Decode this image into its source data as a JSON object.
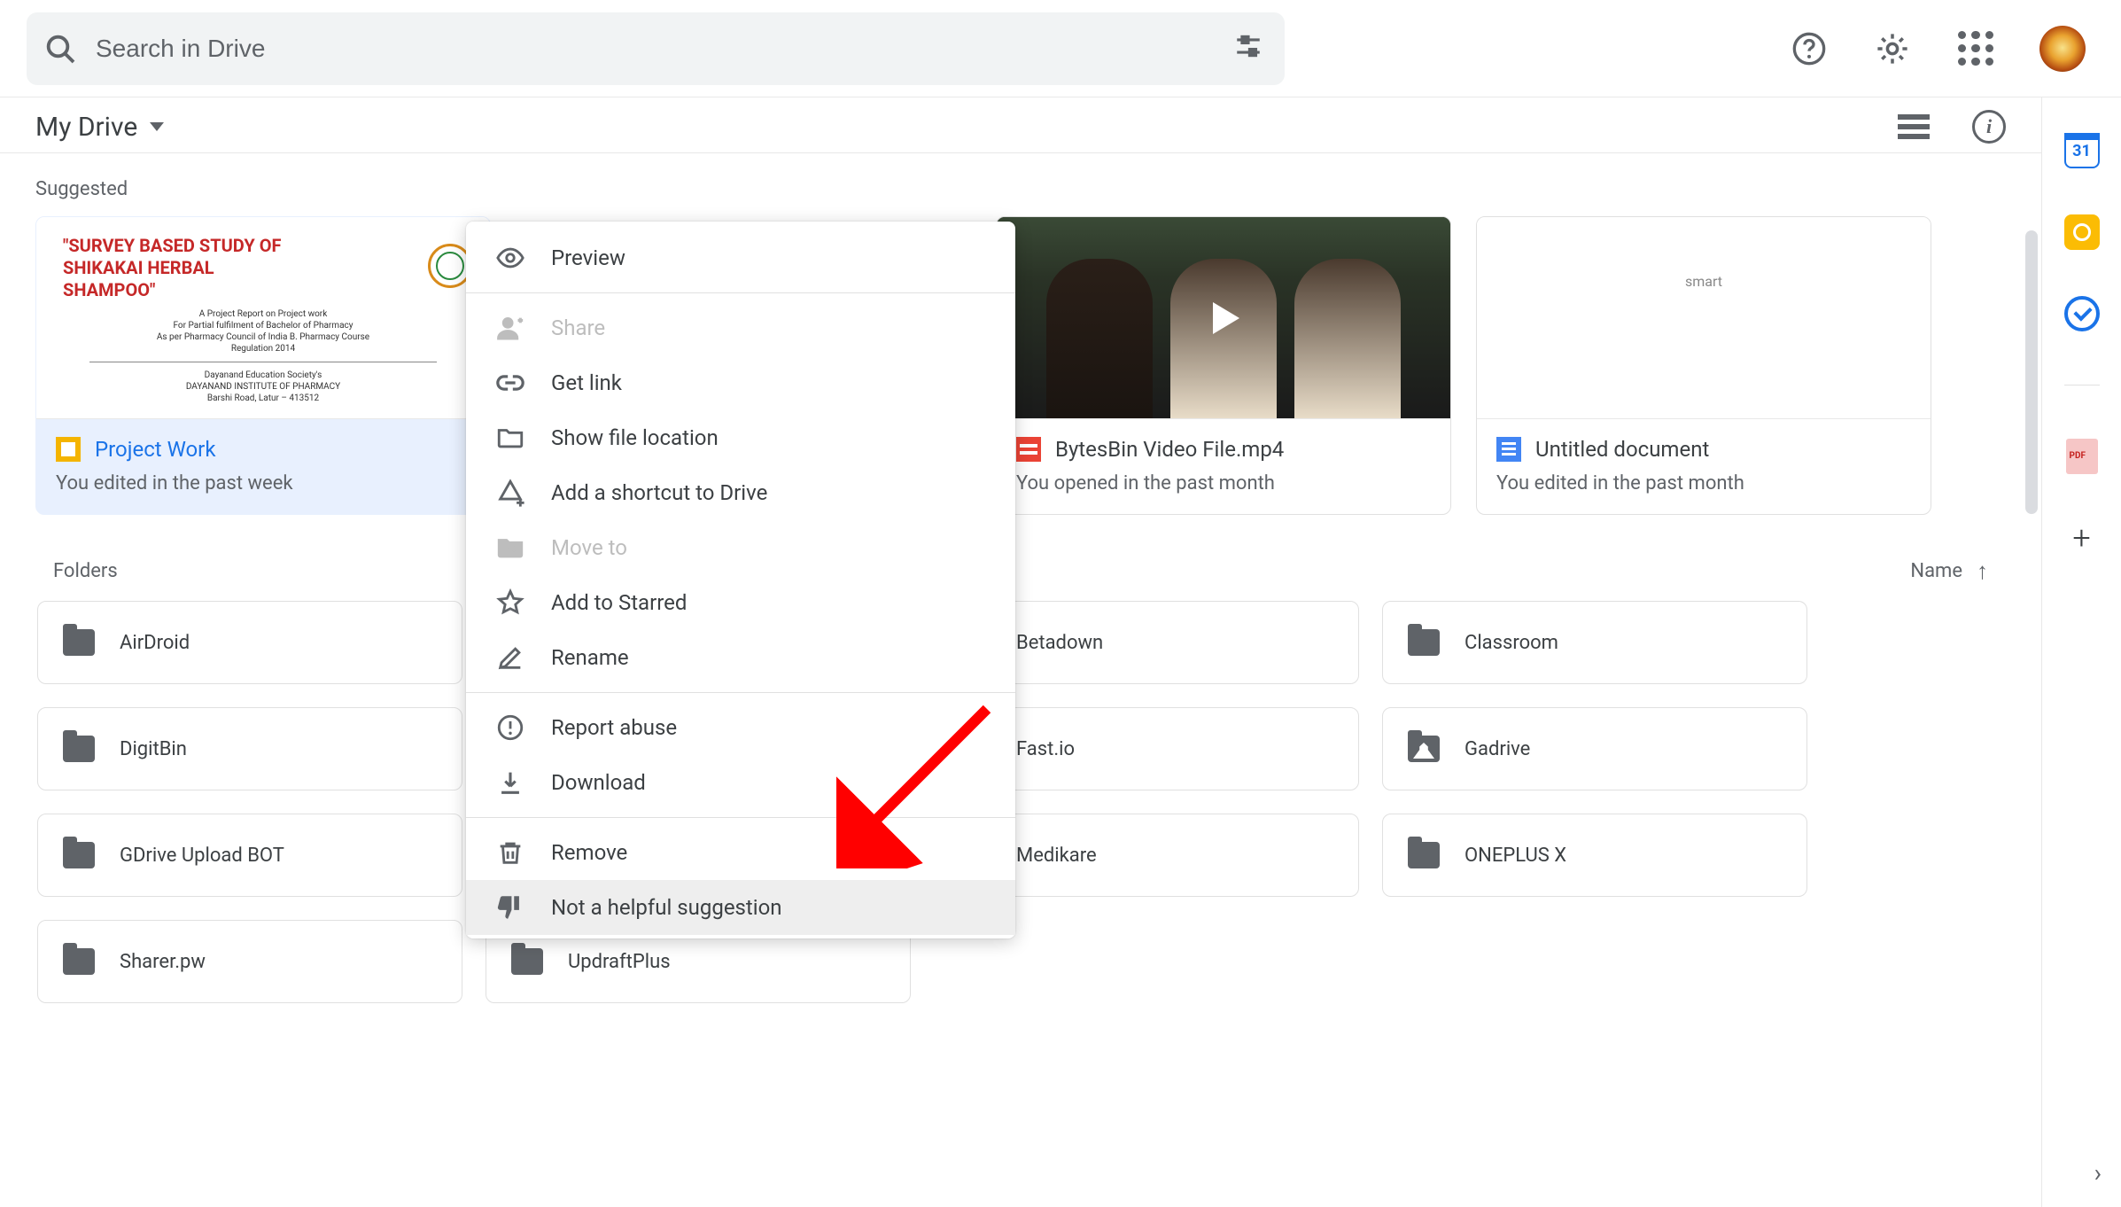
{
  "search": {
    "placeholder": "Search in Drive"
  },
  "breadcrumb": {
    "label": "My Drive"
  },
  "suggested": {
    "heading": "Suggested",
    "cards": [
      {
        "title": "Project Work",
        "subtitle": "You edited in the past week"
      },
      {
        "title": "BytesBin Video File.mp4",
        "subtitle": "You opened in the past month"
      },
      {
        "title": "Untitled document",
        "subtitle": "You edited in the past month"
      }
    ]
  },
  "slides_thumb": {
    "line1": "\"SURVEY BASED STUDY OF",
    "line2": "SHIKAKAI HERBAL",
    "line3": "SHAMPOO\"",
    "sub1": "A Project Report on Project work",
    "sub2": "For Partial fulfilment of Bachelor of Pharmacy",
    "sub3": "As per Pharmacy Council of India B. Pharmacy Course",
    "sub4": "Regulation 2014",
    "sub5": "Dayanand Education Society's",
    "sub6": "DAYANAND INSTITUTE OF PHARMACY",
    "sub7": "Barshi Road, Latur – 413512"
  },
  "doc_thumb_text": "smart",
  "folders": {
    "heading": "Folders",
    "sort_label": "Name",
    "items": [
      "AirDroid",
      "",
      "Betadown",
      "Classroom",
      "DigitBin",
      "",
      "Fast.io",
      "Gadrive",
      "GDrive Upload BOT",
      "",
      "Medikare",
      "ONEPLUS X",
      "Sharer.pw",
      "UpdraftPlus"
    ]
  },
  "context_menu": {
    "preview": "Preview",
    "share": "Share",
    "get_link": "Get link",
    "show_location": "Show file location",
    "add_shortcut": "Add a shortcut to Drive",
    "move_to": "Move to",
    "add_starred": "Add to Starred",
    "rename": "Rename",
    "report_abuse": "Report abuse",
    "download": "Download",
    "remove": "Remove",
    "not_helpful": "Not a helpful suggestion"
  },
  "side_panel": {
    "calendar_day": "31"
  }
}
